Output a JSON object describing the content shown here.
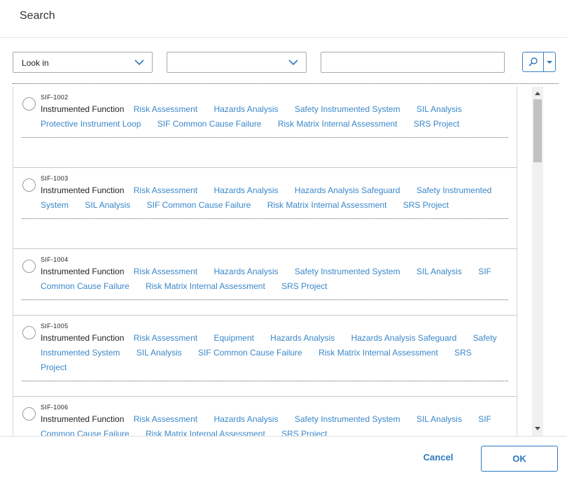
{
  "dialog": {
    "title": "Search"
  },
  "filters": {
    "look_in_value": "Look in",
    "second_value": "",
    "search_value": ""
  },
  "results": [
    {
      "id": "SIF-1002",
      "family": "Instrumented Function",
      "links": [
        "Risk Assessment",
        "Hazards Analysis",
        "Safety Instrumented System",
        "SIL Analysis",
        "Protective Instrument Loop",
        "SIF Common Cause Failure",
        "Risk Matrix Internal Assessment",
        "SRS Project"
      ]
    },
    {
      "id": "SIF-1003",
      "family": "Instrumented Function",
      "links": [
        "Risk Assessment",
        "Hazards Analysis",
        "Hazards Analysis Safeguard",
        "Safety Instrumented System",
        "SIL Analysis",
        "SIF Common Cause Failure",
        "Risk Matrix Internal Assessment",
        "SRS Project"
      ]
    },
    {
      "id": "SIF-1004",
      "family": "Instrumented Function",
      "links": [
        "Risk Assessment",
        "Hazards Analysis",
        "Safety Instrumented System",
        "SIL Analysis",
        "SIF Common Cause Failure",
        "Risk Matrix Internal Assessment",
        "SRS Project"
      ]
    },
    {
      "id": "SIF-1005",
      "family": "Instrumented Function",
      "links": [
        "Risk Assessment",
        "Equipment",
        "Hazards Analysis",
        "Hazards Analysis Safeguard",
        "Safety Instrumented System",
        "SIL Analysis",
        "SIF Common Cause Failure",
        "Risk Matrix Internal Assessment",
        "SRS Project"
      ]
    },
    {
      "id": "SIF-1006",
      "family": "Instrumented Function",
      "links": [
        "Risk Assessment",
        "Hazards Analysis",
        "Safety Instrumented System",
        "SIL Analysis",
        "SIF Common Cause Failure",
        "Risk Matrix Internal Assessment",
        "SRS Project"
      ]
    }
  ],
  "footer": {
    "cancel_label": "Cancel",
    "ok_label": "OK"
  },
  "icons": {
    "search": "search-icon",
    "dropdown": "chevron-down-icon",
    "scroll_up": "triangle-up-icon",
    "scroll_down": "triangle-down-icon"
  },
  "colors": {
    "accent": "#2c78bf",
    "link": "#3a87c9"
  }
}
